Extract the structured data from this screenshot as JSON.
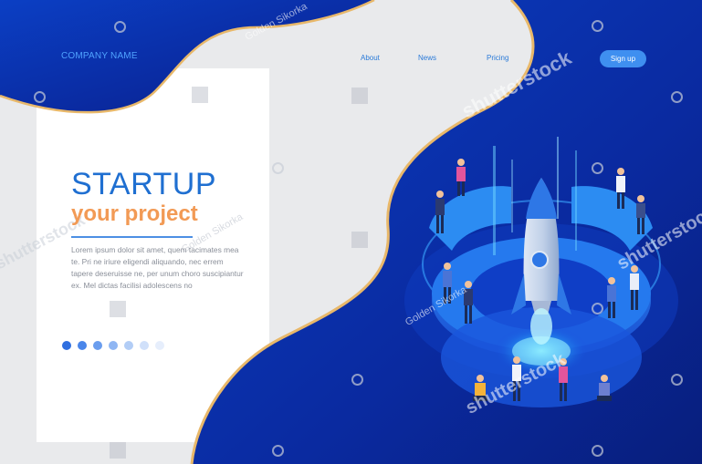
{
  "header": {
    "brand": "COMPANY NAME",
    "nav": [
      {
        "label": "About"
      },
      {
        "label": "News"
      },
      {
        "label": "Pricing"
      }
    ],
    "signup_label": "Sign up"
  },
  "hero": {
    "headline": "STARTUP",
    "subheadline": "your project",
    "body": "Lorem ipsum dolor sit amet, quem tacimates mea te. Pri ne iriure eligendi aliquando, nec errem tapere deseruisse ne, per unum choro suscipiantur ex. Mel dictas facilisi adolescens no"
  },
  "carousel": {
    "dots": [
      {
        "color": "#2f6fe0",
        "active": true
      },
      {
        "color": "#4a86ea"
      },
      {
        "color": "#6a9dee"
      },
      {
        "color": "#8fb6f3"
      },
      {
        "color": "#b2cdf6"
      },
      {
        "color": "#d0e0fa"
      },
      {
        "color": "#e6eefc"
      }
    ]
  },
  "watermarks": {
    "brand": "shutterstock",
    "author": "Golden Sikorka"
  },
  "colors": {
    "deep_blue": "#0a2aa8",
    "accent_blue": "#3f8ff0",
    "gold_edge": "#e8b86a",
    "orange": "#f29a55"
  }
}
